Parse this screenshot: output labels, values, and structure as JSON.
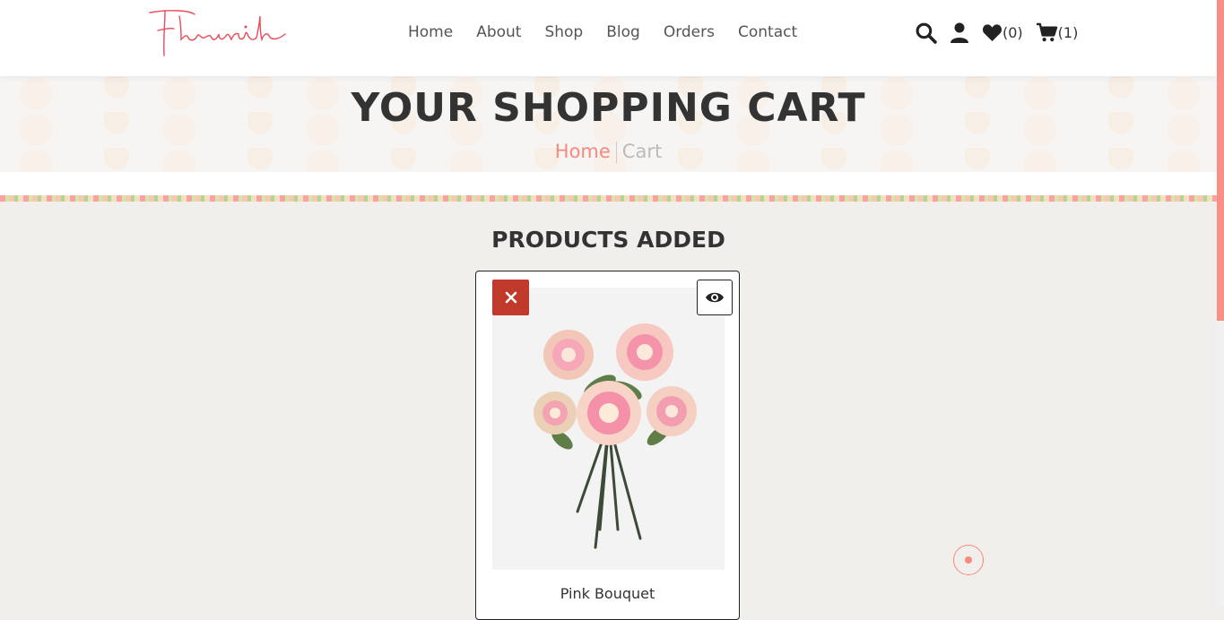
{
  "brand": {
    "logo_text": "Flourish",
    "accent_color": "#f7897d"
  },
  "nav": {
    "items": [
      "Home",
      "About",
      "Shop",
      "Blog",
      "Orders",
      "Contact"
    ]
  },
  "header_icons": {
    "search": "search-icon",
    "user": "user-icon",
    "wishlist": {
      "icon": "heart-icon",
      "count": "(0)"
    },
    "cart": {
      "icon": "cart-icon",
      "count": "(1)"
    }
  },
  "banner": {
    "title": "YOUR SHOPPING CART",
    "breadcrumb_home": "Home",
    "breadcrumb_current": "Cart"
  },
  "main": {
    "section_title": "PRODUCTS ADDED",
    "products": [
      {
        "name": "Pink Bouquet",
        "remove_icon": "close-icon",
        "view_icon": "eye-icon"
      }
    ]
  },
  "colors": {
    "remove_button": "#c0392b",
    "page_bg": "#f1efec"
  }
}
